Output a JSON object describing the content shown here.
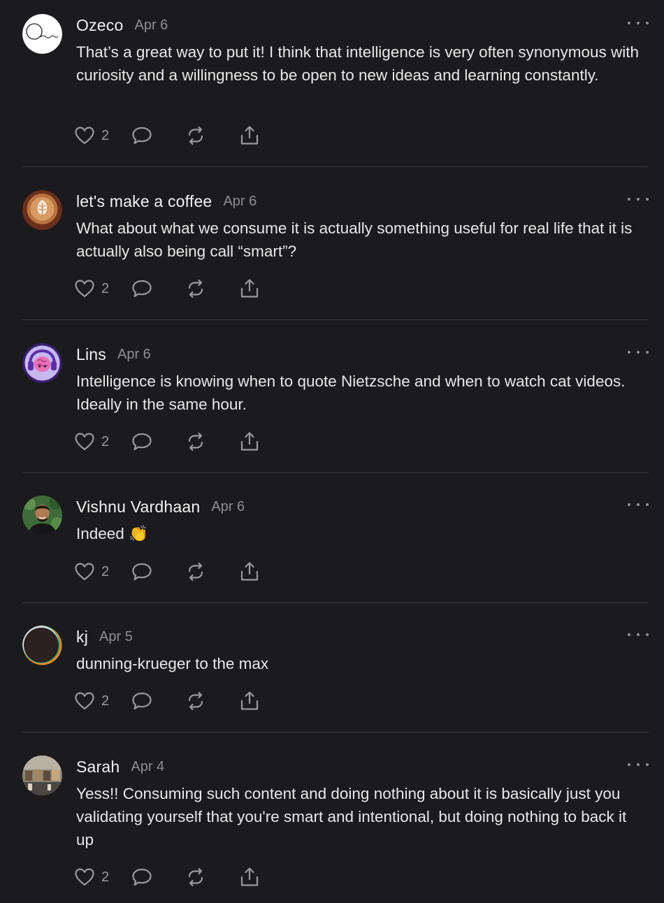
{
  "comments": [
    {
      "author": "Ozeco",
      "date": "Apr 6",
      "text": "That’s a great way to put it! I think that intelligence is very often synonymous with curiosity and a willingness to be open to new ideas and learning constantly.",
      "likes": "2",
      "avatar_icon": "ozeco-logo-icon"
    },
    {
      "author": "let's make a coffee",
      "date": "Apr 6",
      "text": "What about what we consume it is actually something useful for real life that it is actually also being call “smart”?",
      "likes": "2",
      "avatar_icon": "latte-art-avatar"
    },
    {
      "author": "Lins",
      "date": "Apr 6",
      "text": "Intelligence is knowing when to quote Nietzsche and when to watch cat videos. Ideally in the same hour.",
      "likes": "2",
      "avatar_icon": "headphones-brain-avatar"
    },
    {
      "author": "Vishnu Vardhaan",
      "date": "Apr 6",
      "text": "Indeed 👏",
      "likes": "2",
      "avatar_icon": "person-photo-avatar"
    },
    {
      "author": "kj",
      "date": "Apr 5",
      "text": "dunning-krueger to the max",
      "likes": "2",
      "avatar_icon": "eclipse-avatar"
    },
    {
      "author": "Sarah",
      "date": "Apr 4",
      "text": "Yess!! Consuming such content and doing nothing about it is basically just you validating yourself that you're smart and intentional, but doing nothing to back it up",
      "likes": "2",
      "avatar_icon": "storefront-photo-avatar"
    }
  ],
  "icons": {
    "like": "heart-icon",
    "reply": "speech-bubble-icon",
    "restack": "restack-arrows-icon",
    "share": "share-upload-icon",
    "more": "ellipsis-icon"
  },
  "colors": {
    "background": "#1b1b1d",
    "text": "#e8e8e8",
    "muted": "#8e8e93",
    "divider": "#3a3a3c"
  }
}
